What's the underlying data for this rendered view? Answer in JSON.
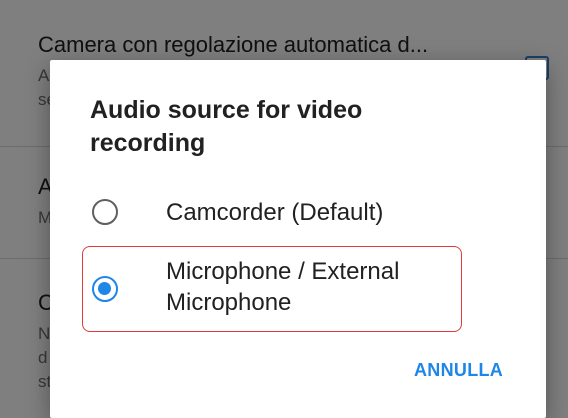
{
  "background": {
    "rows": [
      {
        "title": "Camera con regolazione automatica d...",
        "subtitle_lines": [
          "A",
          "se"
        ]
      },
      {
        "title": "A",
        "subtitle_lines": [
          "M"
        ]
      },
      {
        "title": "C",
        "subtitle_lines": [
          "N",
          "d",
          "st"
        ]
      }
    ]
  },
  "dialog": {
    "title": "Audio source for video recording",
    "options": [
      {
        "label": "Camcorder (Default)",
        "selected": false
      },
      {
        "label": "Microphone / External Microphone",
        "selected": true
      }
    ],
    "cancel_label": "ANNULLA"
  },
  "colors": {
    "accent": "#1e86e6",
    "highlight_border": "#e03a3a"
  }
}
